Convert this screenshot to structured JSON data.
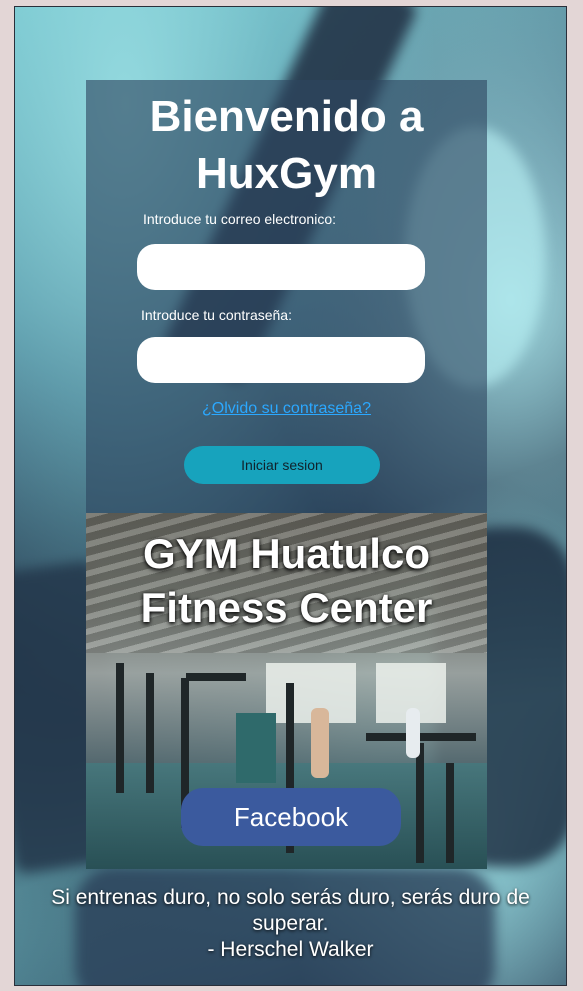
{
  "login": {
    "title": "Bienvenido a HuxGym",
    "email_label": "Introduce tu correo electronico:",
    "email_value": "",
    "password_label": "Introduce tu contraseña:",
    "password_value": "",
    "forgot_link": "¿Olvido su contraseña?",
    "submit_label": "Iniciar sesion"
  },
  "gym": {
    "title": "GYM Huatulco Fitness Center",
    "facebook_label": "Facebook"
  },
  "quote": {
    "text": "Si entrenas duro, no solo serás duro, serás duro de superar.",
    "author": "- Herschel Walker"
  },
  "colors": {
    "accent": "#17a3bd",
    "facebook": "#3b5a9e",
    "link": "#2ba8ff"
  }
}
